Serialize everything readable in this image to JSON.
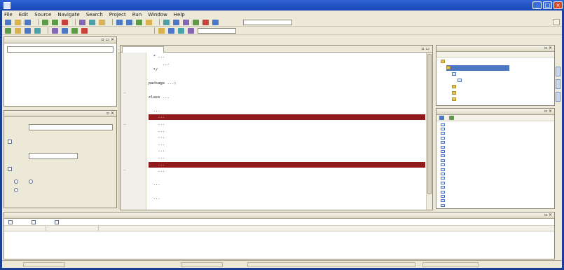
{
  "window": {
    "title": "",
    "min_label": "_",
    "max_label": "□",
    "close_label": "×"
  },
  "menu": [
    "File",
    "Edit",
    "Source",
    "Navigate",
    "Search",
    "Project",
    "Run",
    "Window",
    "Help"
  ],
  "toolbar": {
    "perspective_label": ""
  },
  "left_top_panel": {
    "title": "",
    "field_value": "",
    "label": ""
  },
  "properties_panel": {
    "title": "",
    "section_label": "",
    "type_label": "",
    "type_value": "",
    "checkbox_label": "",
    "value_label": "",
    "value_unit": "",
    "group_label": "",
    "radio1": "",
    "radio2": "",
    "radio3": ""
  },
  "editor": {
    "tab_label": "",
    "lines": [
      {
        "text": "  * ...",
        "hl": false
      },
      {
        "text": "      ...",
        "hl": false
      },
      {
        "text": "  */",
        "hl": false
      },
      {
        "text": "",
        "hl": false
      },
      {
        "text": "package ...;",
        "hl": false
      },
      {
        "text": "",
        "hl": false
      },
      {
        "text": "class ...",
        "hl": false
      },
      {
        "text": "",
        "hl": false
      },
      {
        "text": "  ...",
        "hl": false
      },
      {
        "text": "    ...",
        "hl": true
      },
      {
        "text": "    ...",
        "hl": false
      },
      {
        "text": "    ...",
        "hl": false
      },
      {
        "text": "    ...",
        "hl": false
      },
      {
        "text": "    ...",
        "hl": false
      },
      {
        "text": "    ...",
        "hl": false
      },
      {
        "text": "    ...",
        "hl": false
      },
      {
        "text": "    ...",
        "hl": true
      },
      {
        "text": "    ...",
        "hl": false
      },
      {
        "text": "",
        "hl": false
      },
      {
        "text": "  ...",
        "hl": false
      },
      {
        "text": "",
        "hl": false
      },
      {
        "text": "  ...",
        "hl": false
      }
    ]
  },
  "project_panel": {
    "title": "",
    "items": [
      {
        "label": "",
        "icon": "folder-icon",
        "indent": 0,
        "selected": false
      },
      {
        "label": "",
        "icon": "folder-icon",
        "indent": 1,
        "selected": true
      },
      {
        "label": "",
        "icon": "file-icon",
        "indent": 2,
        "selected": false
      },
      {
        "label": "",
        "icon": "file-icon",
        "indent": 3,
        "selected": false
      },
      {
        "label": "",
        "icon": "folder-icon",
        "indent": 2,
        "selected": false
      },
      {
        "label": "",
        "icon": "folder-icon",
        "indent": 2,
        "selected": false
      },
      {
        "label": "",
        "icon": "folder-icon",
        "indent": 2,
        "selected": false
      }
    ]
  },
  "outline_panel": {
    "title": "",
    "items": [
      "",
      "",
      "",
      "",
      "",
      "",
      "",
      "",
      "",
      "",
      "",
      "",
      "",
      "",
      "",
      "",
      "",
      "",
      ""
    ]
  },
  "messages_panel": {
    "title": "",
    "filters": [
      "",
      "",
      ""
    ],
    "columns": [
      "",
      "",
      ""
    ],
    "rows": [
      {
        "a": "",
        "b": "",
        "c": ""
      },
      {
        "a": "",
        "b": "",
        "c": ""
      },
      {
        "a": "",
        "b": "",
        "c": ""
      },
      {
        "a": "",
        "b": "",
        "c": ""
      }
    ]
  },
  "statusbar": {
    "left": "",
    "mid": "",
    "right": "",
    "far_right": ""
  },
  "colors": {
    "highlight_line": "#8f1b1b",
    "title_bar": "#1a46b3",
    "chrome": "#ece9d8"
  }
}
